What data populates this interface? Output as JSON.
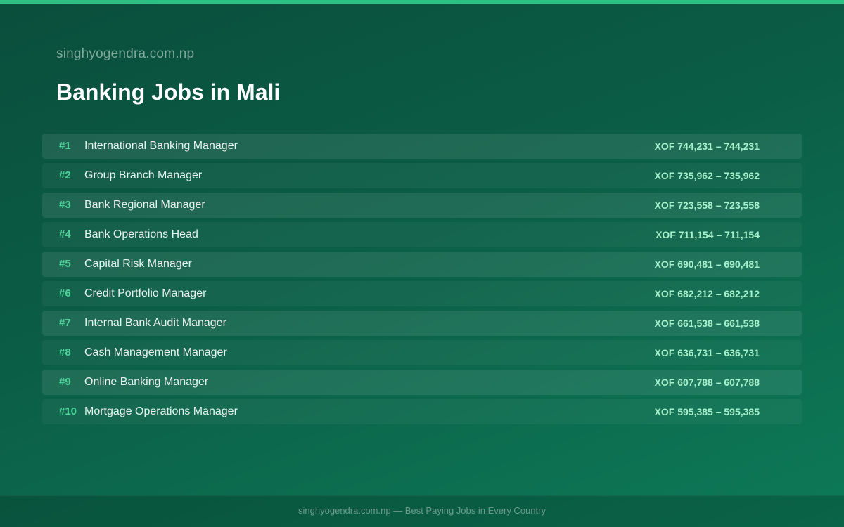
{
  "header": {
    "site_name": "singhyogendra.com.np",
    "title": "Banking Jobs in Mali"
  },
  "jobs": [
    {
      "rank": "#1",
      "title": "International Banking Manager",
      "salary": "XOF 744,231 – 744,231"
    },
    {
      "rank": "#2",
      "title": "Group Branch Manager",
      "salary": "XOF 735,962 – 735,962"
    },
    {
      "rank": "#3",
      "title": "Bank Regional Manager",
      "salary": "XOF 723,558 – 723,558"
    },
    {
      "rank": "#4",
      "title": "Bank Operations Head",
      "salary": "XOF 711,154 – 711,154"
    },
    {
      "rank": "#5",
      "title": "Capital Risk Manager",
      "salary": "XOF 690,481 – 690,481"
    },
    {
      "rank": "#6",
      "title": "Credit Portfolio Manager",
      "salary": "XOF 682,212 – 682,212"
    },
    {
      "rank": "#7",
      "title": "Internal Bank Audit Manager",
      "salary": "XOF 661,538 – 661,538"
    },
    {
      "rank": "#8",
      "title": "Cash Management Manager",
      "salary": "XOF 636,731 – 636,731"
    },
    {
      "rank": "#9",
      "title": "Online Banking Manager",
      "salary": "XOF 607,788 – 607,788"
    },
    {
      "rank": "#10",
      "title": "Mortgage Operations Manager",
      "salary": "XOF 595,385 – 595,385"
    }
  ],
  "footer": {
    "text": "singhyogendra.com.np — Best Paying Jobs in Every Country"
  },
  "colors": {
    "accent": "#2fbf84",
    "rank": "#4cd39a",
    "salary": "#a7f0cc",
    "background_top": "#0a4e3c",
    "background_bottom": "#0d7a57"
  }
}
